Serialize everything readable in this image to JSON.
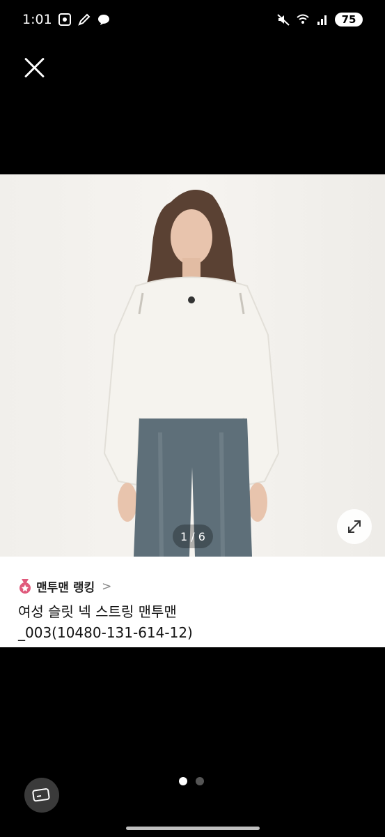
{
  "status_bar": {
    "time": "1:01",
    "battery": "75",
    "left_icons": [
      "screenshot-icon",
      "pencil-icon",
      "messenger-icon"
    ],
    "right_icons": [
      "mute-icon",
      "wifi-icon",
      "signal-icon"
    ]
  },
  "close_icon": "close-icon",
  "image": {
    "counter": "1 / 6",
    "expand_icon": "expand-icon"
  },
  "product": {
    "ranking_label": "맨투맨 랭킹",
    "ranking_chevron": ">",
    "title_line1": "여성 슬릿 넥 스트링 맨투맨",
    "title_line2": "_003(10480-131-614-12)"
  },
  "pager": {
    "total": 2,
    "active": 1
  },
  "card_icon": "card-icon",
  "colors": {
    "background": "#000000",
    "panel": "#ffffff",
    "medal": "#e05a7c"
  }
}
